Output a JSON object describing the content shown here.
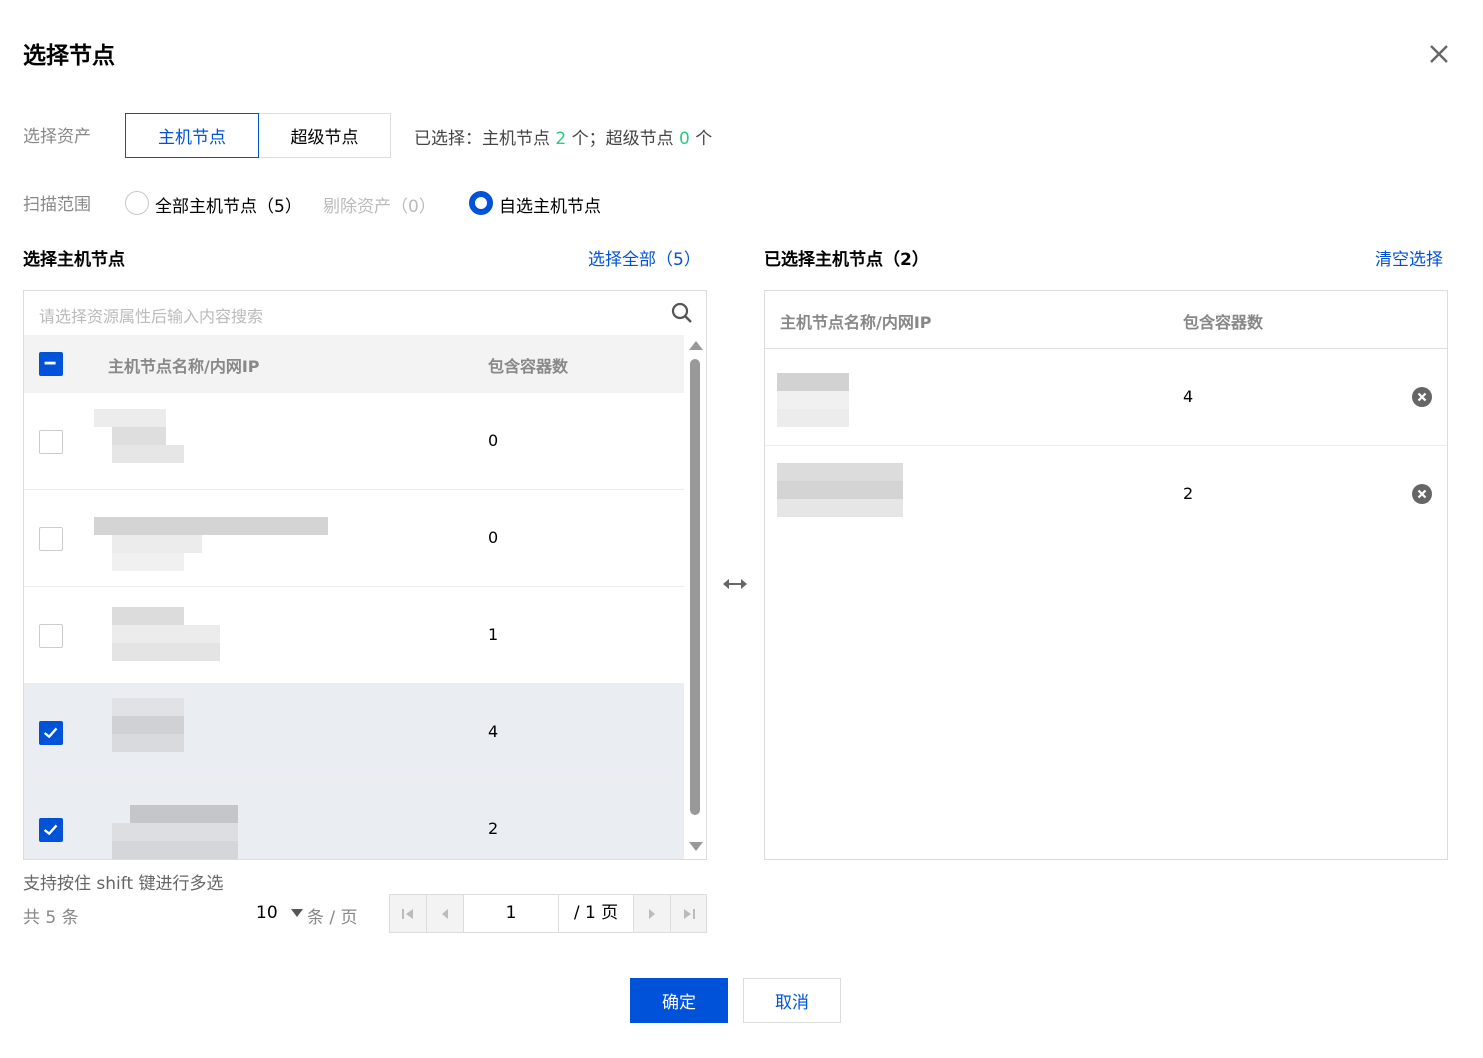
{
  "dialog": {
    "title": "选择节点"
  },
  "asset": {
    "label": "选择资产",
    "tabs": [
      "主机节点",
      "超级节点"
    ],
    "summary_prefix": "已选择：主机节点 ",
    "host_count": "2",
    "summary_mid": " 个；超级节点 ",
    "super_count": "0",
    "summary_suffix": " 个"
  },
  "scope": {
    "label": "扫描范围",
    "options": [
      "全部主机节点（5）",
      "剔除资产（0）",
      "自选主机节点"
    ],
    "selected": "自选主机节点"
  },
  "left": {
    "title": "选择主机节点",
    "select_all": "选择全部（5）",
    "search_placeholder": "请选择资源属性后输入内容搜索",
    "col_name": "主机节点名称/内网IP",
    "col_count": "包含容器数",
    "rows": [
      {
        "count": "0",
        "checked": false
      },
      {
        "count": "0",
        "checked": false
      },
      {
        "count": "1",
        "checked": false
      },
      {
        "count": "4",
        "checked": true
      },
      {
        "count": "2",
        "checked": true
      }
    ],
    "hint": "支持按住 shift 键进行多选",
    "total": "共  5  条",
    "page_size": "10",
    "per_page": "条 / 页",
    "page": "1",
    "page_total": "/ 1 页"
  },
  "right": {
    "title": "已选择主机节点（2）",
    "clear": "清空选择",
    "col_name": "主机节点名称/内网IP",
    "col_count": "包含容器数",
    "rows": [
      {
        "count": "4"
      },
      {
        "count": "2"
      }
    ]
  },
  "footer": {
    "ok": "确定",
    "cancel": "取消"
  },
  "colors": {
    "primary": "#0052d9",
    "success": "#29cc85"
  }
}
